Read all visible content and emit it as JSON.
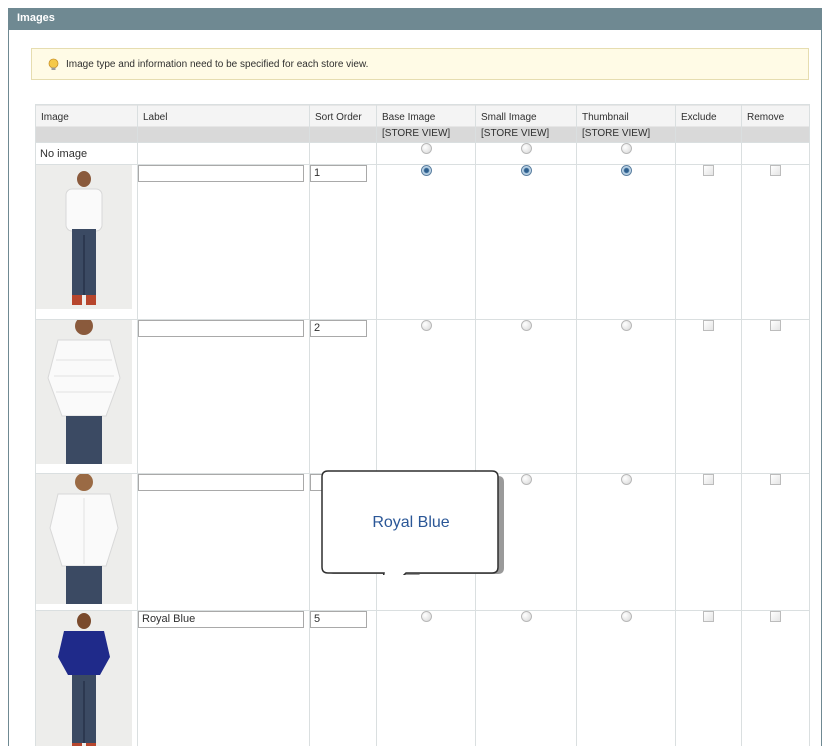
{
  "panel": {
    "title": "Images"
  },
  "notice": {
    "icon": "lightbulb-icon",
    "text": "Image type and information need to be specified for each store view."
  },
  "columns": {
    "image": "Image",
    "label": "Label",
    "sort": "Sort Order",
    "base": "Base Image",
    "base_scope": "[STORE VIEW]",
    "small": "Small Image",
    "small_scope": "[STORE VIEW]",
    "thumb": "Thumbnail",
    "thumb_scope": "[STORE VIEW]",
    "exclude": "Exclude",
    "remove": "Remove"
  },
  "no_image": {
    "label": "No image"
  },
  "rows": [
    {
      "image": "white-top-front-photo",
      "label": "",
      "sort": "1",
      "base": true,
      "small": true,
      "thumbnail": true,
      "exclude": false,
      "remove": false
    },
    {
      "image": "white-top-closeup-photo",
      "label": "",
      "sort": "2",
      "base": false,
      "small": false,
      "thumbnail": false,
      "exclude": false,
      "remove": false
    },
    {
      "image": "white-top-back-photo",
      "label": "",
      "sort": "",
      "base": false,
      "small": false,
      "thumbnail": false,
      "exclude": false,
      "remove": false
    },
    {
      "image": "royal-blue-top-photo",
      "label": "Royal Blue",
      "sort": "5",
      "base": false,
      "small": false,
      "thumbnail": false,
      "exclude": false,
      "remove": false
    }
  ],
  "callout": {
    "text": "Royal Blue"
  },
  "colors": {
    "header_bar": "#6f8992",
    "notice_bg": "#fffbe6",
    "callout_text": "#2b5797",
    "royal_blue": "#1f2a8a"
  }
}
